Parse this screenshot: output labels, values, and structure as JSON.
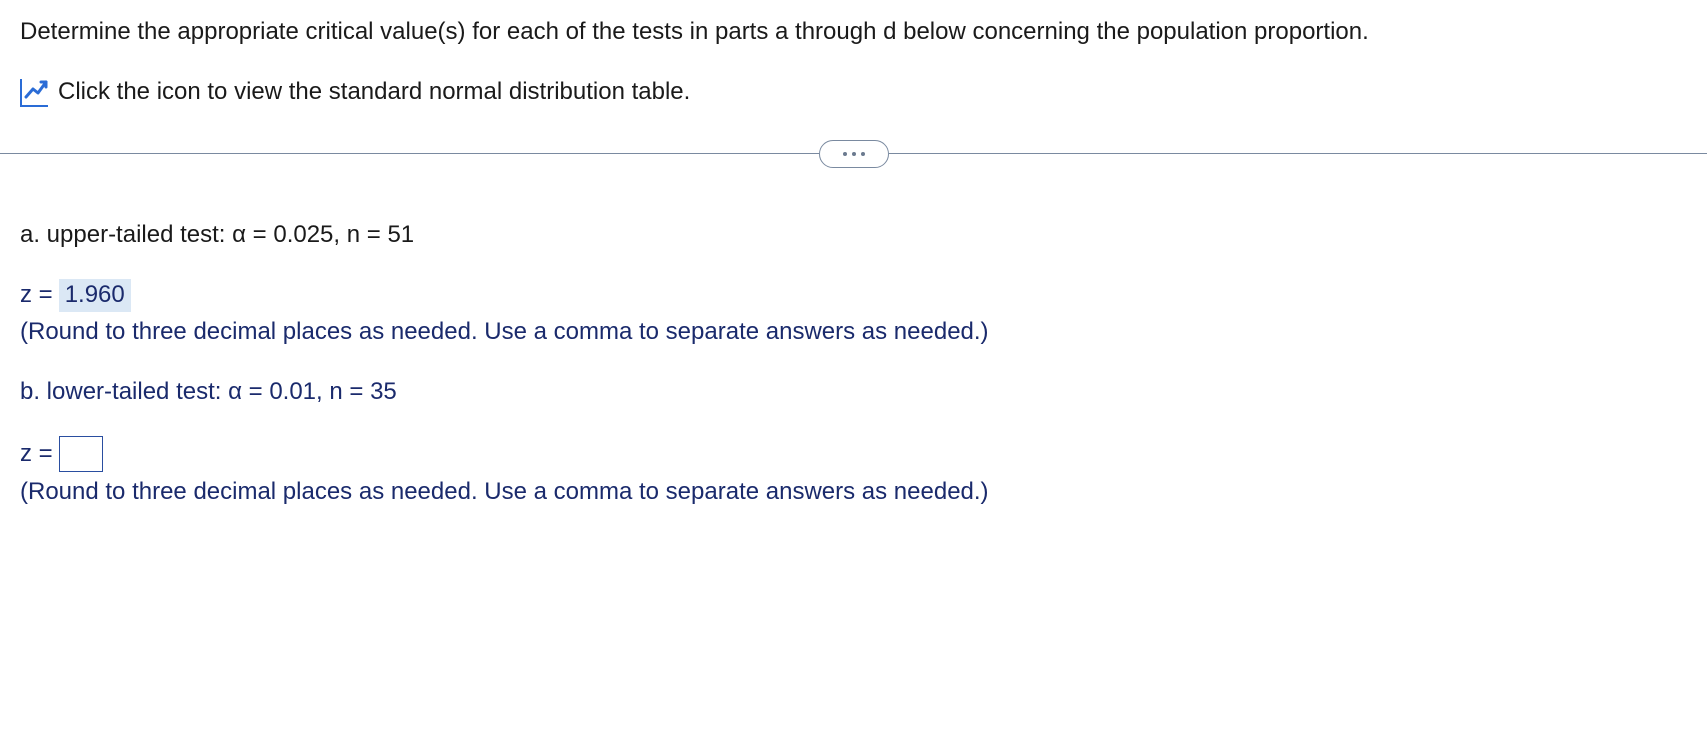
{
  "intro": "Determine the appropriate critical value(s) for each of the tests in parts a through d below concerning the population proportion.",
  "link": {
    "text": "Click the icon to view the standard normal distribution table."
  },
  "parts": {
    "a": {
      "label": "a. upper-tailed test: α = 0.025, n = 51",
      "z_prefix": "z = ",
      "z_value": "1.960",
      "hint": "(Round to three decimal places as needed. Use a comma to separate answers as needed.)"
    },
    "b": {
      "label": "b. lower-tailed test: α = 0.01, n = 35",
      "z_prefix": "z =",
      "z_value": "",
      "hint": "(Round to three decimal places as needed. Use a comma to separate answers as needed.)"
    }
  }
}
